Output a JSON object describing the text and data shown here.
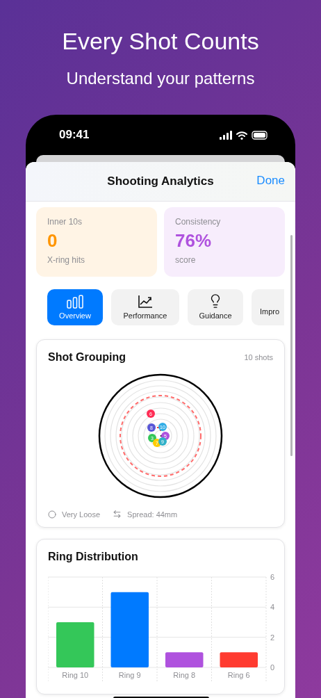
{
  "headline": "Every Shot Counts",
  "subtitle": "Understand your patterns",
  "status_bar": {
    "time": "09:41"
  },
  "sheet": {
    "title": "Shooting Analytics",
    "done": "Done"
  },
  "stats": [
    {
      "label": "Inner 10s",
      "value": "0",
      "caption": "X-ring hits",
      "color": "#ff9500"
    },
    {
      "label": "Consistency",
      "value": "76%",
      "caption": "score",
      "color": "#af52de"
    }
  ],
  "tabs": [
    {
      "label": "Overview",
      "selected": true
    },
    {
      "label": "Performance",
      "selected": false
    },
    {
      "label": "Guidance",
      "selected": false
    },
    {
      "label": "Impro",
      "selected": false
    }
  ],
  "grouping": {
    "title": "Shot Grouping",
    "count": "10 shots",
    "shots": [
      {
        "label": "6",
        "color": "#ff2d55"
      },
      {
        "label": "8",
        "color": "#5856d6"
      },
      {
        "label": "10",
        "color": "#32ade6"
      },
      {
        "label": "3",
        "color": "#34c759"
      },
      {
        "label": "5",
        "color": "#af52de"
      },
      {
        "label": "7",
        "color": "#ffcc00"
      },
      {
        "label": "9",
        "color": "#30b0c7"
      }
    ],
    "tightness": "Very Loose",
    "spread": "Spread: 44mm"
  },
  "distribution": {
    "title": "Ring Distribution",
    "chart_data": {
      "type": "bar",
      "categories": [
        "Ring 10",
        "Ring 9",
        "Ring 8",
        "Ring 6"
      ],
      "series": [
        {
          "color": "#34c759",
          "values": [
            3,
            null,
            null,
            null
          ]
        },
        {
          "color": "#007aff",
          "values": [
            null,
            5,
            null,
            null
          ]
        },
        {
          "color": "#af52de",
          "values": [
            null,
            null,
            1,
            null
          ]
        },
        {
          "color": "#ff3b30",
          "values": [
            null,
            null,
            null,
            1
          ]
        }
      ],
      "stacked": true,
      "ylim": [
        0,
        6
      ],
      "yticks": [
        0,
        2,
        4,
        6
      ]
    }
  }
}
